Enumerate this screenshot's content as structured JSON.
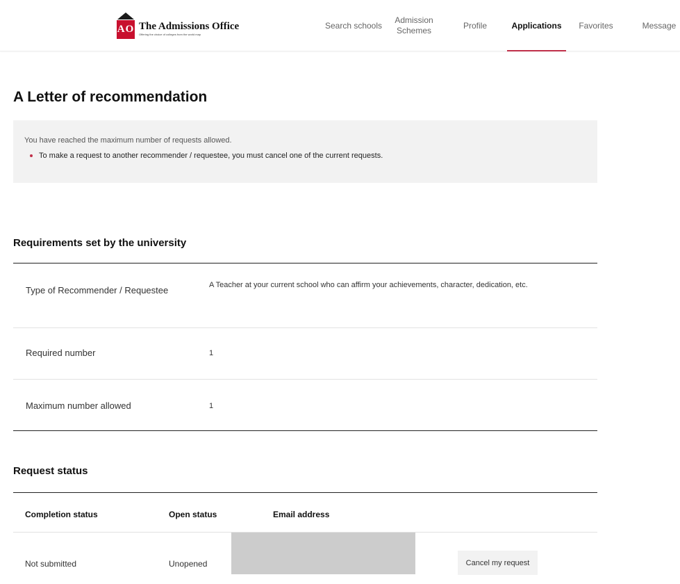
{
  "header": {
    "logo_mark_text": "AO",
    "logo_title": "The Admissions Office",
    "logo_tagline": "Offering the choice of colleges from the world map",
    "nav": [
      {
        "label": "Search schools"
      },
      {
        "label": "Admission Schemes"
      },
      {
        "label": "Profile"
      },
      {
        "label": "Applications",
        "active": true
      },
      {
        "label": "Favorites"
      },
      {
        "label": "Message"
      }
    ],
    "accent_color": "#c0304a"
  },
  "page_title": "A Letter of recommendation",
  "notice": {
    "message": "You have reached the maximum number of requests allowed.",
    "bullet": "To make a request to another recommender / requestee, you must cancel one of the current requests."
  },
  "requirements": {
    "heading": "Requirements set by the university",
    "rows": [
      {
        "label": "Type of Recommender / Requestee",
        "value": "A Teacher at your current school who can affirm your achievements, character, dedication, etc."
      },
      {
        "label": "Required number",
        "value": "1"
      },
      {
        "label": "Maximum number allowed",
        "value": "1"
      }
    ]
  },
  "request_status": {
    "heading": "Request status",
    "columns": [
      "Completion status",
      "Open status",
      "Email address"
    ],
    "rows": [
      {
        "completion": "Not submitted",
        "open": "Unopened",
        "action": "Cancel my request"
      }
    ]
  }
}
